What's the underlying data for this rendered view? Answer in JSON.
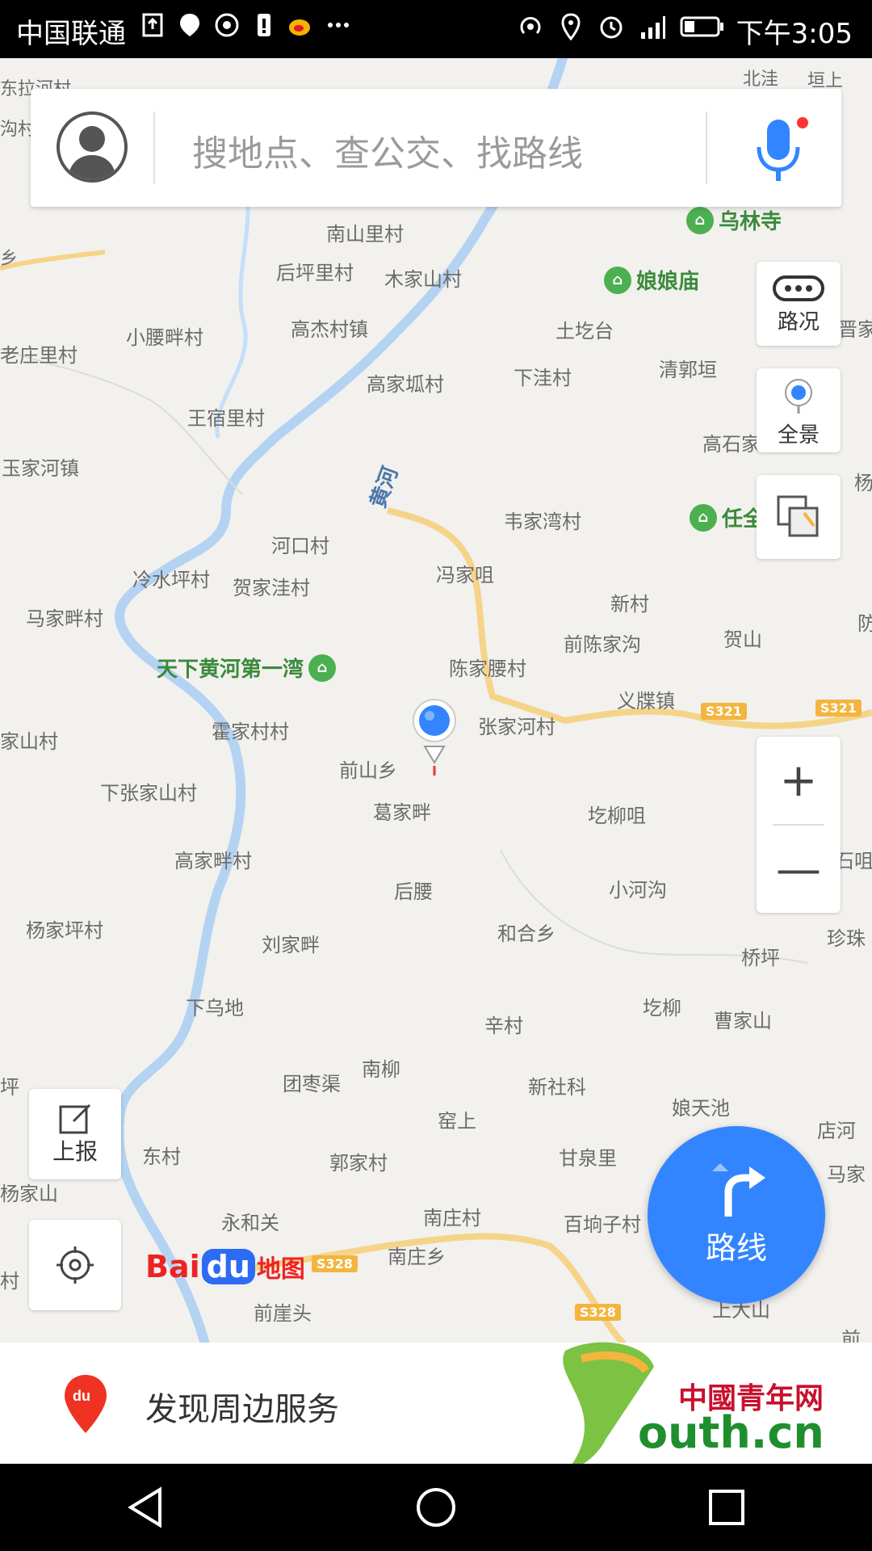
{
  "status_bar": {
    "carrier": "中国联通",
    "time": "下午3:05",
    "icons": [
      "upload-icon",
      "baidu-map-icon",
      "chrome-icon",
      "alert-icon",
      "weibo-icon",
      "more-icon",
      "hotspot-icon",
      "location-icon",
      "alarm-icon",
      "signal-icon",
      "battery-icon"
    ]
  },
  "search": {
    "placeholder": "搜地点、查公交、找路线"
  },
  "map": {
    "place_labels": [
      {
        "text": "东拉河村"
      },
      {
        "text": "北洼"
      },
      {
        "text": "垣上"
      },
      {
        "text": "沟村"
      },
      {
        "text": "南山里村"
      },
      {
        "text": "乡"
      },
      {
        "text": "后坪里村"
      },
      {
        "text": "木家山村"
      },
      {
        "text": "小腰畔村"
      },
      {
        "text": "高杰村镇"
      },
      {
        "text": "土圪台"
      },
      {
        "text": "晋家"
      },
      {
        "text": "老庄里村"
      },
      {
        "text": "高家坬村"
      },
      {
        "text": "下洼村"
      },
      {
        "text": "清郭垣"
      },
      {
        "text": "王宿里村"
      },
      {
        "text": "高石家"
      },
      {
        "text": "玉家河镇"
      },
      {
        "text": "杨"
      },
      {
        "text": "韦家湾村"
      },
      {
        "text": "河口村"
      },
      {
        "text": "冯家咀"
      },
      {
        "text": "冷水坪村"
      },
      {
        "text": "贺家洼村"
      },
      {
        "text": "新村"
      },
      {
        "text": "马家畔村"
      },
      {
        "text": "前陈家沟"
      },
      {
        "text": "贺山"
      },
      {
        "text": "陈家腰村"
      },
      {
        "text": "义牒镇"
      },
      {
        "text": "霍家村村"
      },
      {
        "text": "张家河村"
      },
      {
        "text": "家山村"
      },
      {
        "text": "前山乡"
      },
      {
        "text": "下张家山村"
      },
      {
        "text": "葛家畔"
      },
      {
        "text": "圪柳咀"
      },
      {
        "text": "高家畔村"
      },
      {
        "text": "后腰"
      },
      {
        "text": "小河沟"
      },
      {
        "text": "杨家坪村"
      },
      {
        "text": "刘家畔"
      },
      {
        "text": "和合乡"
      },
      {
        "text": "桥坪"
      },
      {
        "text": "珍珠"
      },
      {
        "text": "下乌地"
      },
      {
        "text": "圪柳"
      },
      {
        "text": "辛村"
      },
      {
        "text": "曹家山"
      },
      {
        "text": "南柳"
      },
      {
        "text": "团枣渠"
      },
      {
        "text": "新社科"
      },
      {
        "text": "娘天池"
      },
      {
        "text": "窑上"
      },
      {
        "text": "店河"
      },
      {
        "text": "东村"
      },
      {
        "text": "郭家村"
      },
      {
        "text": "甘泉里"
      },
      {
        "text": "马家"
      },
      {
        "text": "杨家山"
      },
      {
        "text": "永和关"
      },
      {
        "text": "南庄村"
      },
      {
        "text": "百垧子村"
      },
      {
        "text": "南庄乡"
      },
      {
        "text": "前崖头"
      },
      {
        "text": "上大山"
      },
      {
        "text": "前"
      },
      {
        "text": "坪"
      },
      {
        "text": "村"
      },
      {
        "text": "防"
      },
      {
        "text": "石咀"
      }
    ],
    "pois": [
      {
        "text": "乌林寺"
      },
      {
        "text": "娘娘庙"
      },
      {
        "text": "任全"
      },
      {
        "text": "天下黄河第一湾"
      }
    ],
    "river_label": "黄河",
    "road_signs": [
      "S321",
      "S321",
      "S328",
      "S328"
    ],
    "colors": {
      "river": "#b4d3f2",
      "road": "#f5d48a",
      "poi": "#4caf50",
      "accent": "#3385ff"
    }
  },
  "controls": {
    "traffic_label": "路况",
    "panorama_label": "全景",
    "zoom_in": "+",
    "zoom_out": "—",
    "report_label": "上报",
    "route_label": "路线"
  },
  "logo": {
    "bai": "Bai",
    "du": "du",
    "ditu": "地图"
  },
  "bottom": {
    "discover_label": "发现周边服务"
  },
  "watermark": {
    "china": "中國青年网",
    "site": "outh.cn"
  }
}
